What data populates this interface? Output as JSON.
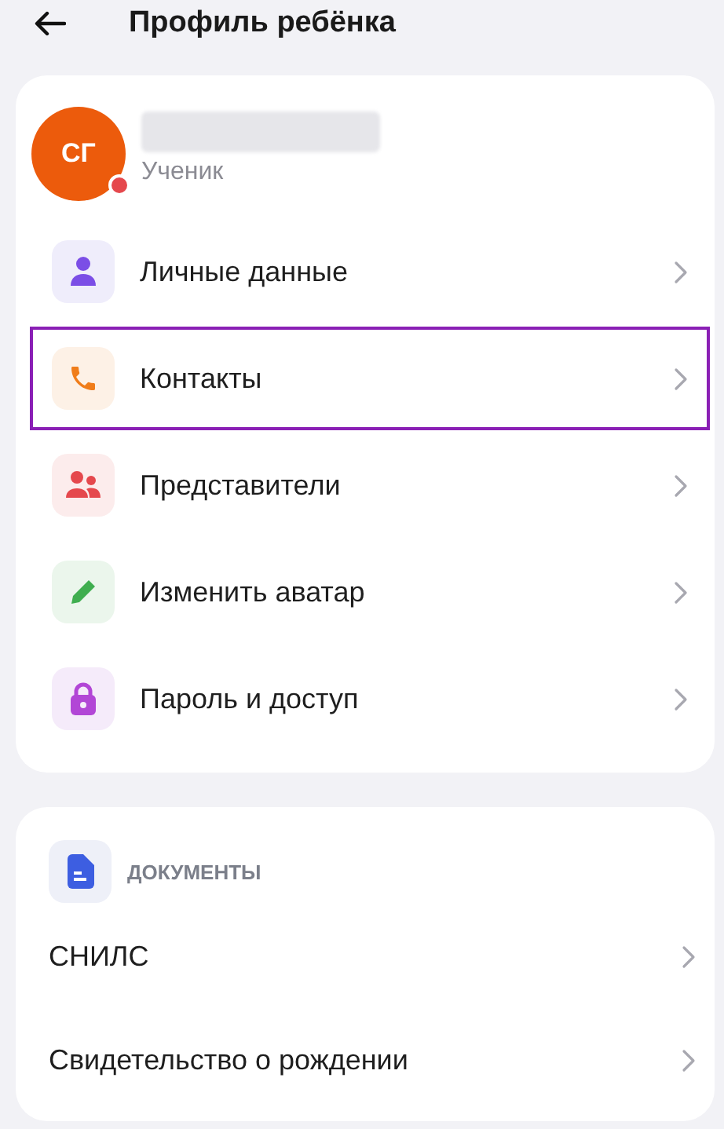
{
  "header": {
    "title": "Профиль ребёнка"
  },
  "profile": {
    "initials": "СГ",
    "role": "Ученик"
  },
  "menu": [
    {
      "label": "Личные данные",
      "highlighted": false
    },
    {
      "label": "Контакты",
      "highlighted": true
    },
    {
      "label": "Представители",
      "highlighted": false
    },
    {
      "label": "Изменить аватар",
      "highlighted": false
    },
    {
      "label": "Пароль и доступ",
      "highlighted": false
    }
  ],
  "documents": {
    "title": "ДОКУМЕНТЫ",
    "items": [
      {
        "label": "СНИЛС"
      },
      {
        "label": "Свидетельство о рождении"
      }
    ]
  }
}
